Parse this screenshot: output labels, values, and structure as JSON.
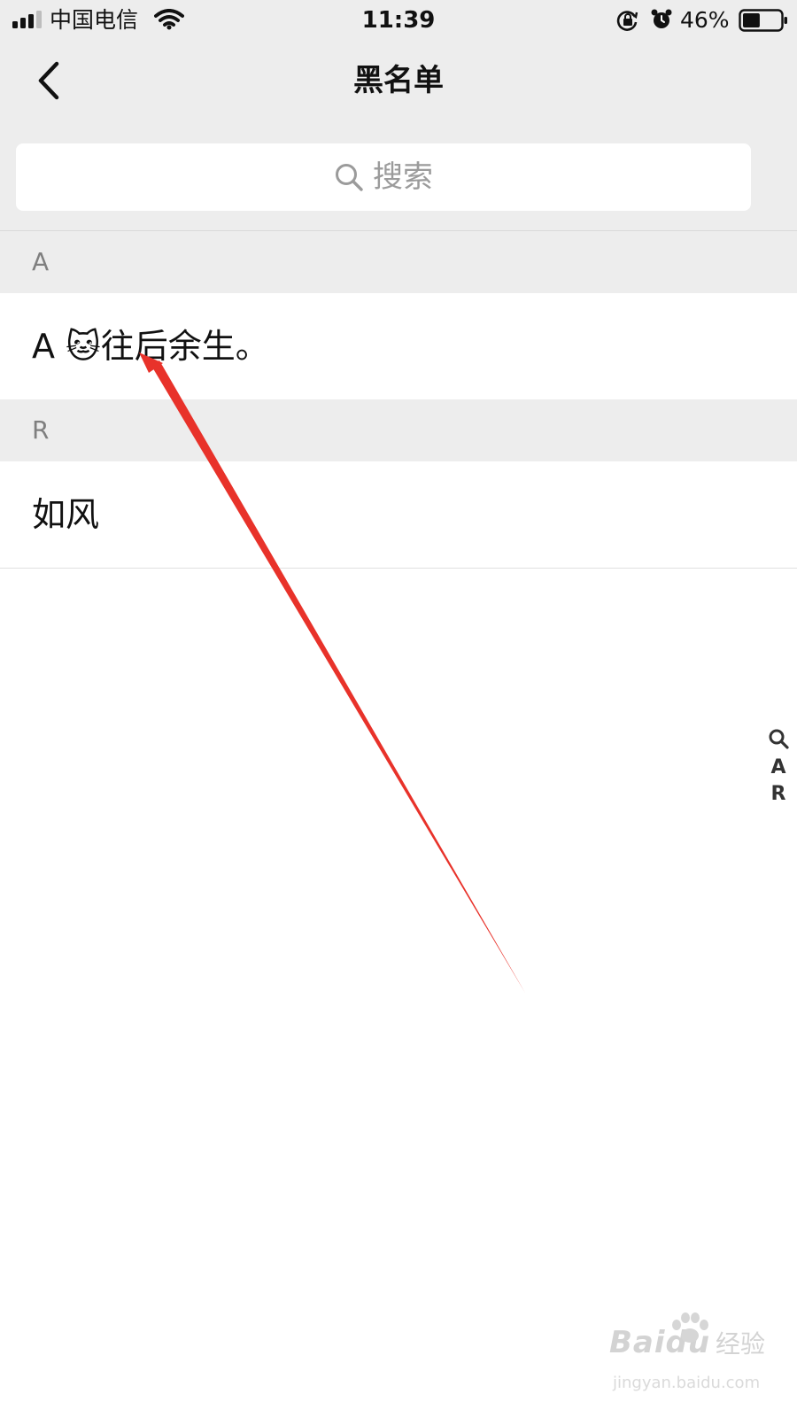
{
  "status_bar": {
    "carrier": "中国电信",
    "time": "11:39",
    "battery": "46%",
    "battery_level": 0.46,
    "icons": [
      "signal-icon",
      "wifi-icon",
      "orientation-lock-icon",
      "alarm-icon",
      "battery-icon"
    ]
  },
  "header": {
    "title": "黑名单",
    "back_icon": "chevron-left-icon"
  },
  "search": {
    "placeholder": "搜索",
    "icon": "search-icon"
  },
  "sections": [
    {
      "letter": "A",
      "items": [
        {
          "name": "A 🐱往后余生。"
        }
      ]
    },
    {
      "letter": "R",
      "items": [
        {
          "name": "如风"
        }
      ]
    }
  ],
  "index_bar": {
    "icon": "search-icon",
    "letters": [
      "A",
      "R"
    ]
  },
  "annotation": {
    "type": "arrow",
    "color": "#e8322a"
  },
  "watermark": {
    "logo": "Baidu",
    "label": "经验",
    "url": "jingyan.baidu.com"
  }
}
